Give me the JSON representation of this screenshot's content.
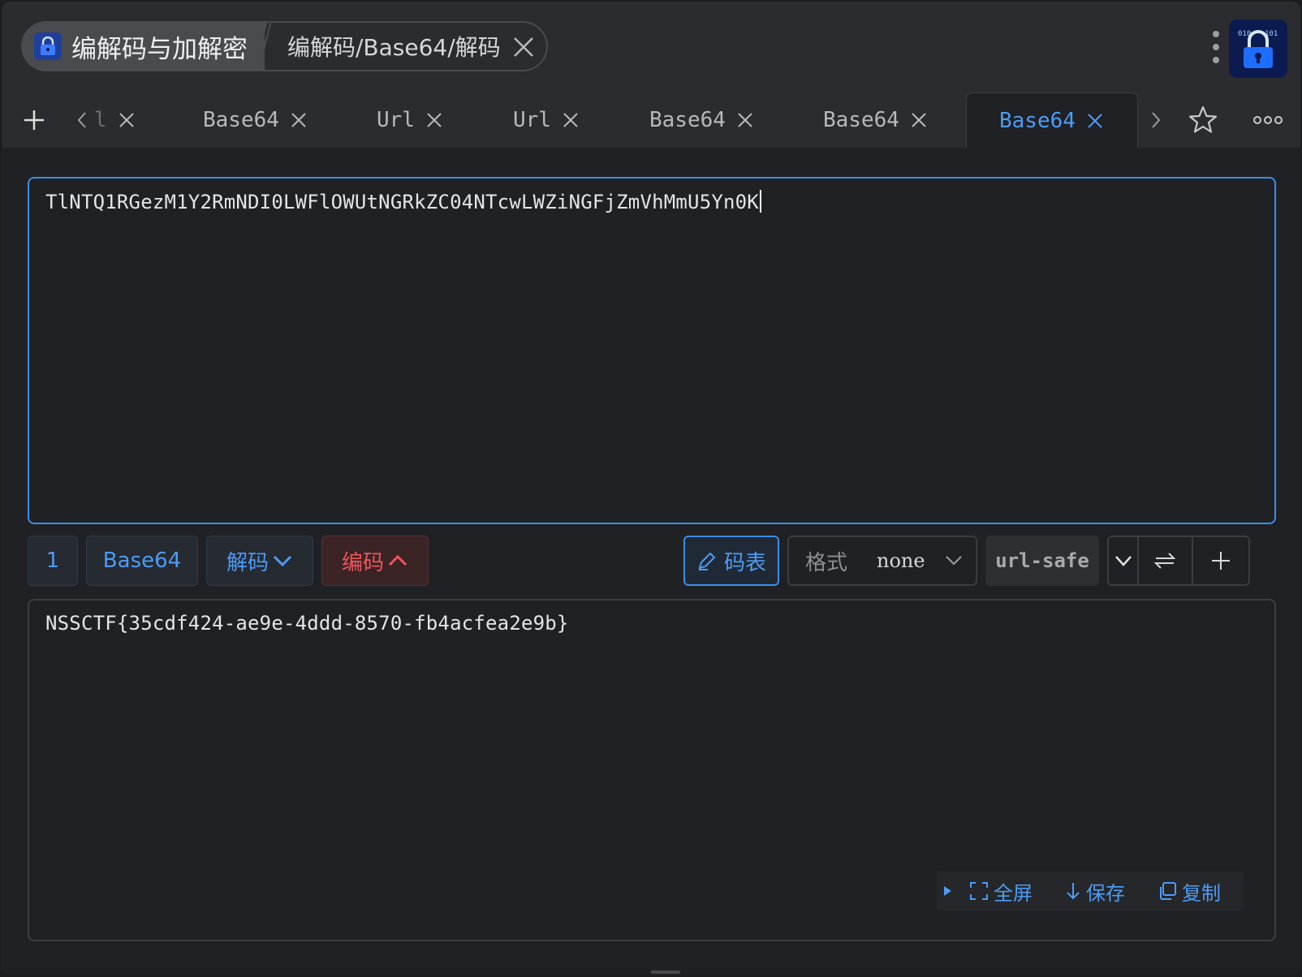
{
  "header": {
    "app_name": "编解码与加解密",
    "page_path": "编解码/Base64/解码"
  },
  "tabs": [
    {
      "label": "l",
      "active": false
    },
    {
      "label": "Base64",
      "active": false
    },
    {
      "label": "Url",
      "active": false
    },
    {
      "label": "Url",
      "active": false
    },
    {
      "label": "Base64",
      "active": false
    },
    {
      "label": "Base64",
      "active": false
    },
    {
      "label": "Base64",
      "active": true
    }
  ],
  "input": {
    "value": "TlNTQ1RGezM1Y2RmNDI0LWFlOWUtNGRkZC04NTcwLWZiNGFjZmVhMmU5Yn0K"
  },
  "toolbar": {
    "count": "1",
    "algorithm": "Base64",
    "decode_label": "解码",
    "encode_label": "编码",
    "code_table_label": "码表",
    "format_label": "格式",
    "format_value": "none",
    "url_safe_label": "url-safe"
  },
  "output": {
    "value": "NSSCTF{35cdf424-ae9e-4ddd-8570-fb4acfea2e9b}",
    "fullscreen_label": "全屏",
    "save_label": "保存",
    "copy_label": "复制"
  },
  "colors": {
    "accent": "#4c9cf5",
    "danger": "#f0555c",
    "background": "#202124"
  }
}
